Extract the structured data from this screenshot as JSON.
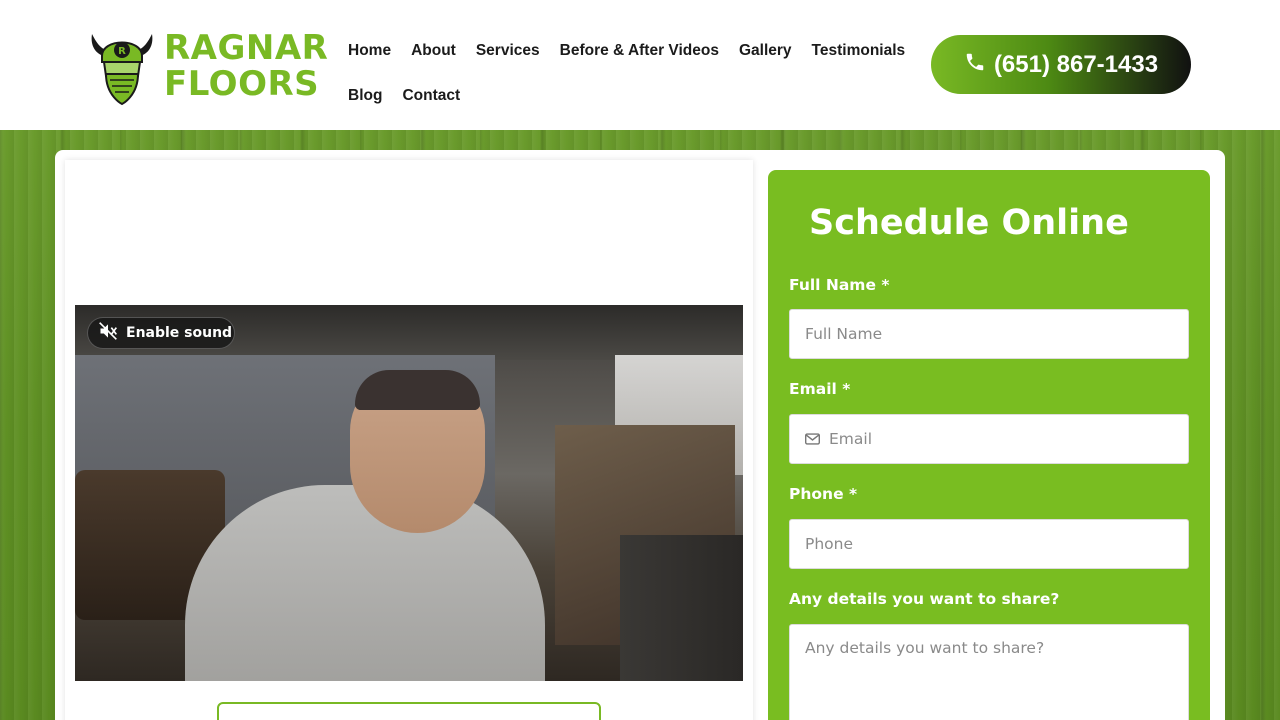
{
  "header": {
    "logo": {
      "line1": "RAGNAR",
      "line2": "FLOORS",
      "badge_letter": "R"
    },
    "nav": {
      "row1": [
        "Home",
        "About",
        "Services",
        "Before & After Videos",
        "Gallery",
        "Testimonials"
      ],
      "row2": [
        "Blog",
        "Contact"
      ]
    },
    "phone": {
      "label": "(651) 867-1433",
      "icon": "phone-icon"
    }
  },
  "video": {
    "sound_button": {
      "label": "Enable sound",
      "icon": "muted-speaker-icon"
    }
  },
  "form": {
    "title": "Schedule Online",
    "fields": {
      "full_name": {
        "label": "Full Name *",
        "placeholder": "Full Name"
      },
      "email": {
        "label": "Email *",
        "placeholder": "Email",
        "icon": "envelope-icon"
      },
      "phone": {
        "label": "Phone *",
        "placeholder": "Phone"
      },
      "details": {
        "label": "Any details you want to share?",
        "placeholder": "Any details you want to share?"
      }
    }
  },
  "colors": {
    "brand_green": "#79b924",
    "form_green": "#79bd21",
    "nav_text": "#1b1b1b"
  }
}
